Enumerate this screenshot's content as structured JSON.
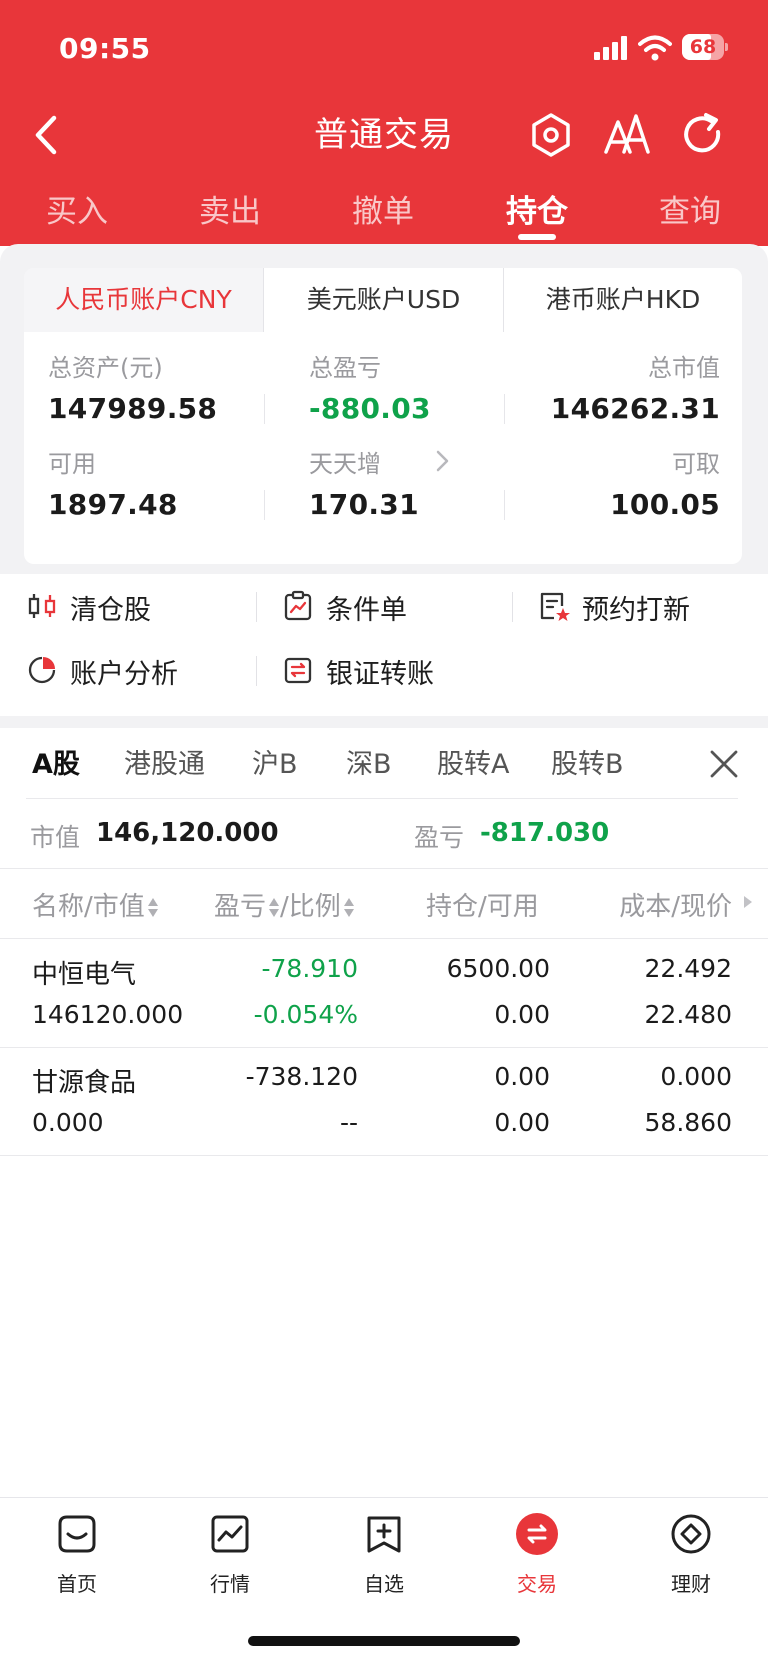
{
  "status_bar": {
    "time": "09:55",
    "battery": "68",
    "battery_level": 0.68
  },
  "nav": {
    "title": "普通交易",
    "icons": [
      "back-icon",
      "settings-hexagon-icon",
      "font-size-icon",
      "refresh-icon"
    ]
  },
  "trade_tabs": [
    "买入",
    "卖出",
    "撤单",
    "持仓",
    "查询"
  ],
  "active_trade_tab": "持仓",
  "account": {
    "currency_tabs": [
      "人民币账户CNY",
      "美元账户USD",
      "港币账户HKD"
    ],
    "active_currency": "人民币账户CNY",
    "metrics": {
      "total_assets_label": "总资产(元)",
      "total_assets": "147989.58",
      "total_pl_label": "总盈亏",
      "total_pl": "-880.03",
      "market_value_label": "总市值",
      "market_value": "146262.31",
      "available_label": "可用",
      "available": "1897.48",
      "daily_label": "天天增",
      "daily": "170.31",
      "withdrawable_label": "可取",
      "withdrawable": "100.05"
    }
  },
  "quick_actions": [
    {
      "label": "清仓股",
      "icon": "clear-position-icon"
    },
    {
      "label": "条件单",
      "icon": "conditional-order-icon"
    },
    {
      "label": "预约打新",
      "icon": "ipo-subscribe-icon"
    },
    {
      "label": "账户分析",
      "icon": "pie-chart-icon"
    },
    {
      "label": "银证转账",
      "icon": "bank-transfer-icon"
    }
  ],
  "market_tabs": [
    "A股",
    "港股通",
    "沪B",
    "深B",
    "股转A",
    "股转B"
  ],
  "active_market_tab": "A股",
  "summary": {
    "mv_label": "市值",
    "mv_value": "146,120.000",
    "pl_label": "盈亏",
    "pl_value": "-817.030"
  },
  "columns": {
    "name": "名称/市值",
    "pl": "盈亏",
    "ratio": "/比例",
    "position": "持仓/可用",
    "cost": "成本/现价"
  },
  "holdings": [
    {
      "name": "中恒电气",
      "market_value": "146120.000",
      "pl": "-78.910",
      "ratio": "-0.054%",
      "position": "6500.00",
      "available": "0.00",
      "cost": "22.492",
      "price": "22.480",
      "green": true
    },
    {
      "name": "甘源食品",
      "market_value": "0.000",
      "pl": "-738.120",
      "ratio": "--",
      "position": "0.00",
      "available": "0.00",
      "cost": "0.000",
      "price": "58.860",
      "green": false
    }
  ],
  "bottom_nav": [
    {
      "label": "首页",
      "icon": "home-icon"
    },
    {
      "label": "行情",
      "icon": "market-chart-icon"
    },
    {
      "label": "自选",
      "icon": "watchlist-add-icon"
    },
    {
      "label": "交易",
      "icon": "trade-exchange-icon"
    },
    {
      "label": "理财",
      "icon": "wealth-icon"
    }
  ],
  "active_bottom": "交易",
  "colors": {
    "brand_red": "#e8363a",
    "loss_green": "#0fa24a",
    "panel_gray": "#f2f2f4"
  }
}
